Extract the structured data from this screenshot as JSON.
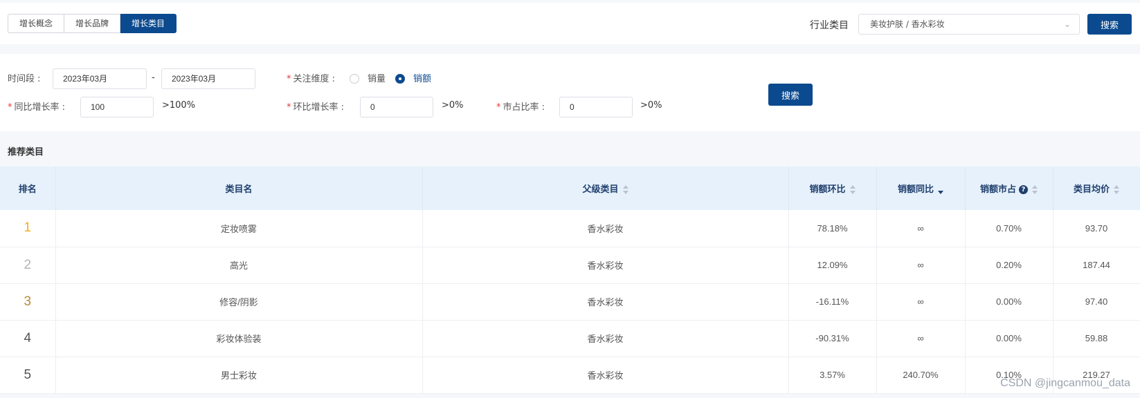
{
  "tabs": [
    {
      "label": "增长概念",
      "active": false
    },
    {
      "label": "增长品牌",
      "active": false
    },
    {
      "label": "增长类目",
      "active": true
    }
  ],
  "industry": {
    "label": "行业类目",
    "value": "美妆护肤 / 香水彩妆",
    "search_label": "搜索"
  },
  "filters": {
    "period_label": "时间段 :",
    "start": "2023年03月",
    "separator": "-",
    "end": "2023年03月",
    "dimension_label": "关注维度 :",
    "dimension_options": [
      "销量",
      "销额"
    ],
    "dimension_selected": "销额",
    "yoy_label": "同比增长率 :",
    "yoy_value": "100",
    "yoy_suffix": ">100%",
    "mom_label": "环比增长率 :",
    "mom_value": "0",
    "mom_suffix": ">0%",
    "share_label": "市占比率 :",
    "share_value": "0",
    "share_suffix": ">0%",
    "search_label": "搜索"
  },
  "section_title": "推荐类目",
  "table": {
    "headers": [
      "排名",
      "类目名",
      "父级类目",
      "销额环比",
      "销额同比",
      "销额市占",
      "类目均价"
    ],
    "rows": [
      [
        "1",
        "定妆喷雾",
        "香水彩妆",
        "78.18%",
        "∞",
        "0.70%",
        "93.70"
      ],
      [
        "2",
        "高光",
        "香水彩妆",
        "12.09%",
        "∞",
        "0.20%",
        "187.44"
      ],
      [
        "3",
        "修容/阴影",
        "香水彩妆",
        "-16.11%",
        "∞",
        "0.00%",
        "97.40"
      ],
      [
        "4",
        "彩妆体验装",
        "香水彩妆",
        "-90.31%",
        "∞",
        "0.00%",
        "59.88"
      ],
      [
        "5",
        "男士彩妆",
        "香水彩妆",
        "3.57%",
        "240.70%",
        "0.10%",
        "219.27"
      ]
    ]
  },
  "watermark": "CSDN @jingcanmou_data",
  "colors": {
    "accent": "#0c4a8f",
    "header_bg": "#e6f1fb"
  }
}
